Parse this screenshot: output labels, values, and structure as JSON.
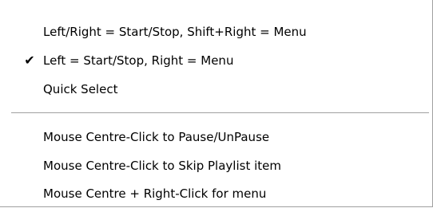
{
  "menu": {
    "items": [
      {
        "label": "Left/Right = Start/Stop, Shift+Right = Menu",
        "checked": false
      },
      {
        "label": "Left = Start/Stop, Right = Menu",
        "checked": true
      },
      {
        "label": "Quick Select",
        "checked": false
      },
      {
        "label": "Mouse Centre-Click to Pause/UnPause",
        "checked": false
      },
      {
        "label": "Mouse Centre-Click to Skip Playlist item",
        "checked": false
      },
      {
        "label": "Mouse Centre + Right-Click for menu",
        "checked": false
      }
    ],
    "check_glyph": "✔"
  }
}
